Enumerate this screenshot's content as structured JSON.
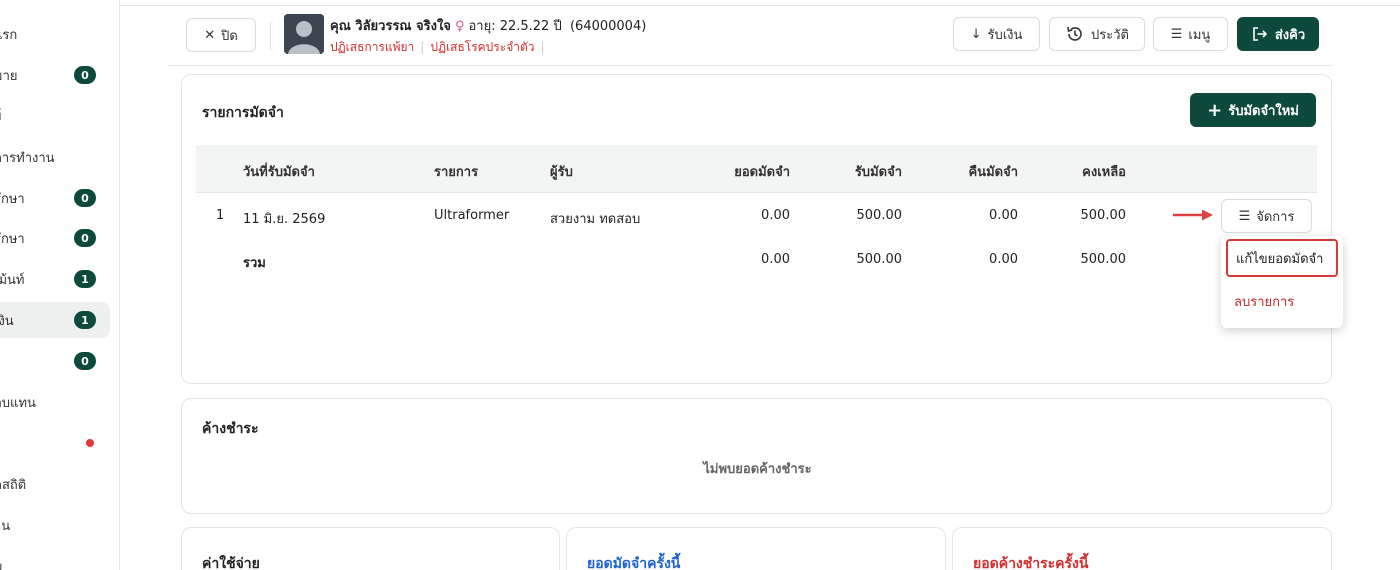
{
  "sidebar": {
    "items": [
      {
        "label": "แรก",
        "badge": ""
      },
      {
        "label": "มาย",
        "badge": "0"
      },
      {
        "label": "ย์",
        "badge": ""
      },
      {
        "label": "การทำงาน",
        "badge": ""
      },
      {
        "label": "รักษา",
        "badge": "0"
      },
      {
        "label": "รักษา",
        "badge": "0"
      },
      {
        "label": "เม้นท์",
        "badge": "1"
      },
      {
        "label": "เงิน",
        "badge": "1"
      },
      {
        "label": "",
        "badge": "0"
      },
      {
        "label": "อบแทน",
        "badge": ""
      },
      {
        "label": "",
        "badge": ""
      },
      {
        "label": "ลสถิติ",
        "badge": ""
      },
      {
        "label": "าน",
        "badge": ""
      },
      {
        "label": "ม",
        "badge": ""
      }
    ]
  },
  "header": {
    "close_label": "ปิด",
    "patient_name": "คุณ วิลัยวรรณ จริงใจ",
    "age": "อายุ: 22.5.22 ปี",
    "patient_id": "(64000004)",
    "drug_allergy": "ปฏิเสธการแพ้ยา",
    "chronic_disease": "ปฏิเสธโรคประจำตัว",
    "receive_money_label": "รับเงิน",
    "history_label": "ประวัติ",
    "menu_label": "เมนู",
    "send_queue_label": "ส่งคิว"
  },
  "deposit": {
    "title": "รายการมัดจำ",
    "new_button": "รับมัดจำใหม่",
    "columns": [
      "วันที่รับมัดจำ",
      "รายการ",
      "ผู้รับ",
      "ยอดมัดจำ",
      "รับมัดจำ",
      "คืนมัดจำ",
      "คงเหลือ"
    ],
    "rows": [
      {
        "no": "1",
        "date": "11 มิ.ย. 2569",
        "item": "Ultraformer",
        "receiver": "สวยงาม ทดสอบ",
        "deposit_amount": "0.00",
        "received": "500.00",
        "returned": "0.00",
        "balance": "500.00"
      }
    ],
    "total": {
      "label": "รวม",
      "deposit_amount": "0.00",
      "received": "500.00",
      "returned": "0.00",
      "balance": "500.00"
    },
    "manage_label": "จัดการ",
    "menu_items": [
      "แก้ไขยอดมัดจำ",
      "ลบรายการ"
    ]
  },
  "outstanding": {
    "title": "ค้างชำระ",
    "empty_text": "ไม่พบยอดค้างชำระ"
  },
  "bottom_cards": {
    "expenses_title": "ค่าใช้จ่าย",
    "deposit_this_time_title": "ยอดมัดจำครั้งนี้",
    "outstanding_this_time_title": "ยอดค้างชำระครั้งนี้"
  },
  "colors": {
    "brand_dark": "#0d4a3c",
    "danger": "#d32f2f",
    "blue": "#1e63d6"
  }
}
